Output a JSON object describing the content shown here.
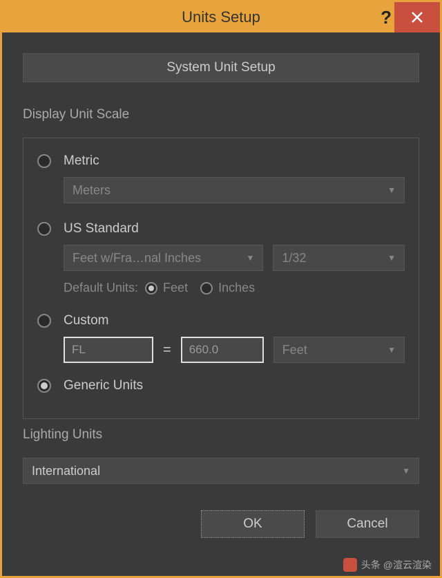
{
  "titlebar": {
    "title": "Units Setup",
    "help": "?",
    "close": "×"
  },
  "system_button": "System Unit Setup",
  "display_scale": {
    "label": "Display Unit Scale",
    "metric": {
      "label": "Metric",
      "value": "Meters"
    },
    "us": {
      "label": "US Standard",
      "value": "Feet w/Fra…nal Inches",
      "fraction": "1/32",
      "default_label": "Default Units:",
      "feet": "Feet",
      "inches": "Inches"
    },
    "custom": {
      "label": "Custom",
      "unit_name": "FL",
      "equals": "=",
      "value": "660.0",
      "unit": "Feet"
    },
    "generic": {
      "label": "Generic Units"
    }
  },
  "lighting": {
    "label": "Lighting Units",
    "value": "International"
  },
  "buttons": {
    "ok": "OK",
    "cancel": "Cancel"
  },
  "watermark": "头条 @渲云渲染"
}
